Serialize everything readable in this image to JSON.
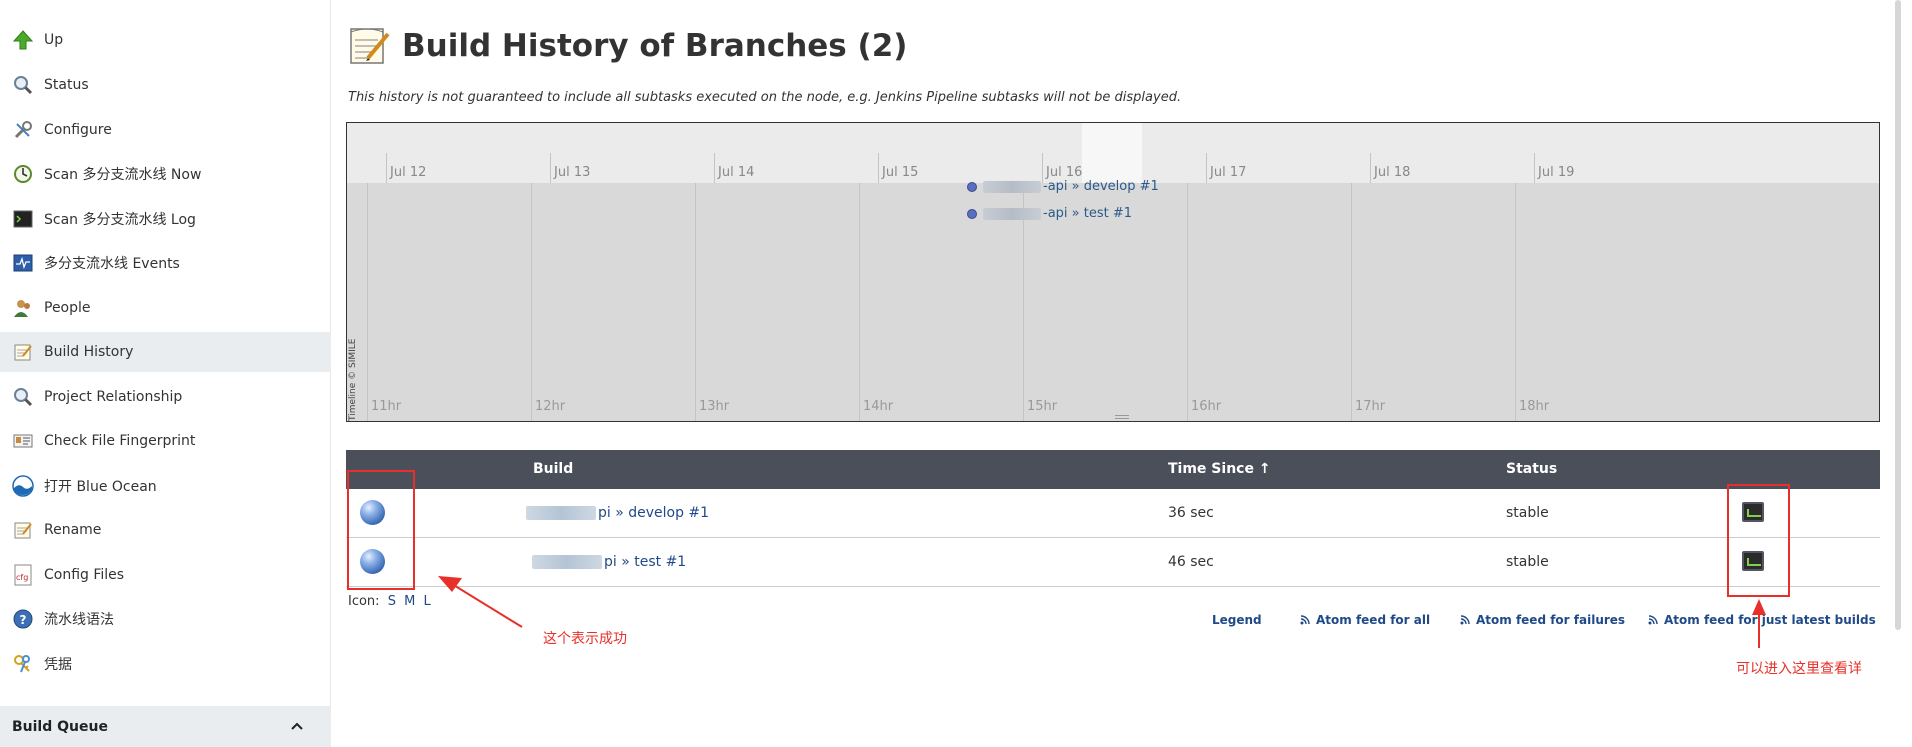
{
  "sidebar": {
    "items": [
      {
        "label": "Up",
        "icon": "up-arrow-icon"
      },
      {
        "label": "Status",
        "icon": "magnifier-icon"
      },
      {
        "label": "Configure",
        "icon": "wrench-icon"
      },
      {
        "label": "Scan 多分支流水线 Now",
        "icon": "scan-clock-icon"
      },
      {
        "label": "Scan 多分支流水线 Log",
        "icon": "terminal-icon"
      },
      {
        "label": "多分支流水线 Events",
        "icon": "events-icon"
      },
      {
        "label": "People",
        "icon": "people-icon"
      },
      {
        "label": "Build History",
        "icon": "notepad-icon"
      },
      {
        "label": "Project Relationship",
        "icon": "magnifier-icon"
      },
      {
        "label": "Check File Fingerprint",
        "icon": "fingerprint-icon"
      },
      {
        "label": "打开 Blue Ocean",
        "icon": "blue-ocean-icon"
      },
      {
        "label": "Rename",
        "icon": "notepad-icon"
      },
      {
        "label": "Config Files",
        "icon": "cfg-icon"
      },
      {
        "label": "流水线语法",
        "icon": "help-icon"
      },
      {
        "label": "凭据",
        "icon": "keys-icon"
      }
    ],
    "build_queue": "Build Queue"
  },
  "main": {
    "title": "Build History of Branches (2)",
    "note": "This history is not guaranteed to include all subtasks executed on the node, e.g. Jenkins Pipeline subtasks will not be displayed."
  },
  "timeline": {
    "dates": [
      "Jul 12",
      "Jul 13",
      "Jul 14",
      "Jul 15",
      "Jul 16",
      "Jul 17",
      "Jul 18",
      "Jul 19"
    ],
    "hours": [
      "11hr",
      "12hr",
      "13hr",
      "14hr",
      "15hr",
      "16hr",
      "17hr",
      "18hr"
    ],
    "events": [
      "-api » develop #1",
      "-api » test #1"
    ],
    "credit": "Timeline © SIMILE"
  },
  "table": {
    "headers": {
      "build": "Build",
      "time_since": "Time Since ↑",
      "status": "Status"
    },
    "rows": [
      {
        "build": "pi » develop #1",
        "time_since": "36 sec",
        "status": "stable"
      },
      {
        "build": "pi » test #1",
        "time_since": "46 sec",
        "status": "stable"
      }
    ]
  },
  "icon_size": {
    "label": "Icon:",
    "sizes": [
      "S",
      "M",
      "L"
    ]
  },
  "feeds": {
    "legend": "Legend",
    "all": "Atom feed for all",
    "failures": "Atom feed for failures",
    "latest": "Atom feed for just latest builds"
  },
  "annotations": {
    "success_note": "这个表示成功",
    "details_note": "可以进入这里查看详"
  },
  "colors": {
    "annotation": "#e8302a",
    "table_header": "#4a4f5a",
    "link": "#204a87"
  }
}
